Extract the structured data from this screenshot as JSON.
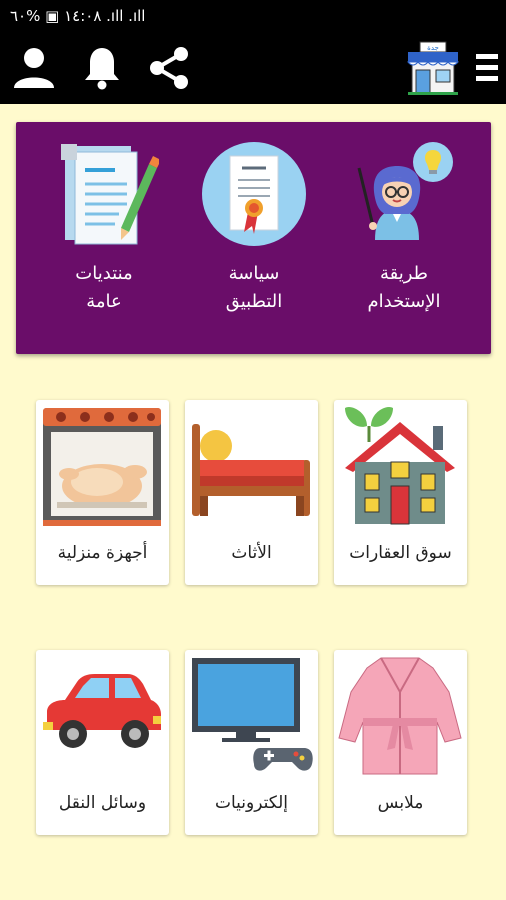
{
  "status_bar": {
    "text": "١٤:٠٨ ▣ %٦٠ .ıll .ıll"
  },
  "app_bar": {
    "icons": [
      "profile-icon",
      "bell-icon",
      "share-icon",
      "store-icon",
      "menu-icon"
    ],
    "store_sign": "جدة"
  },
  "banner": {
    "items": [
      {
        "label": "طريقة\nالإستخدام",
        "icon": "teacher-icon"
      },
      {
        "label": "سياسة\nالتطبيق",
        "icon": "certificate-icon"
      },
      {
        "label": "منتديات\nعامة",
        "icon": "document-pen-icon"
      }
    ]
  },
  "categories": [
    {
      "label": "سوق العقارات",
      "icon": "house-icon"
    },
    {
      "label": "الأثاث",
      "icon": "bed-icon"
    },
    {
      "label": "أجهزة منزلية",
      "icon": "oven-icon"
    },
    {
      "label": "ملابس",
      "icon": "robe-icon"
    },
    {
      "label": "إلكترونيات",
      "icon": "tv-gamepad-icon"
    },
    {
      "label": "وسائل النقل",
      "icon": "car-icon"
    }
  ],
  "colors": {
    "banner": "#6a0d69",
    "background": "#fffacd",
    "bar": "#000000"
  }
}
